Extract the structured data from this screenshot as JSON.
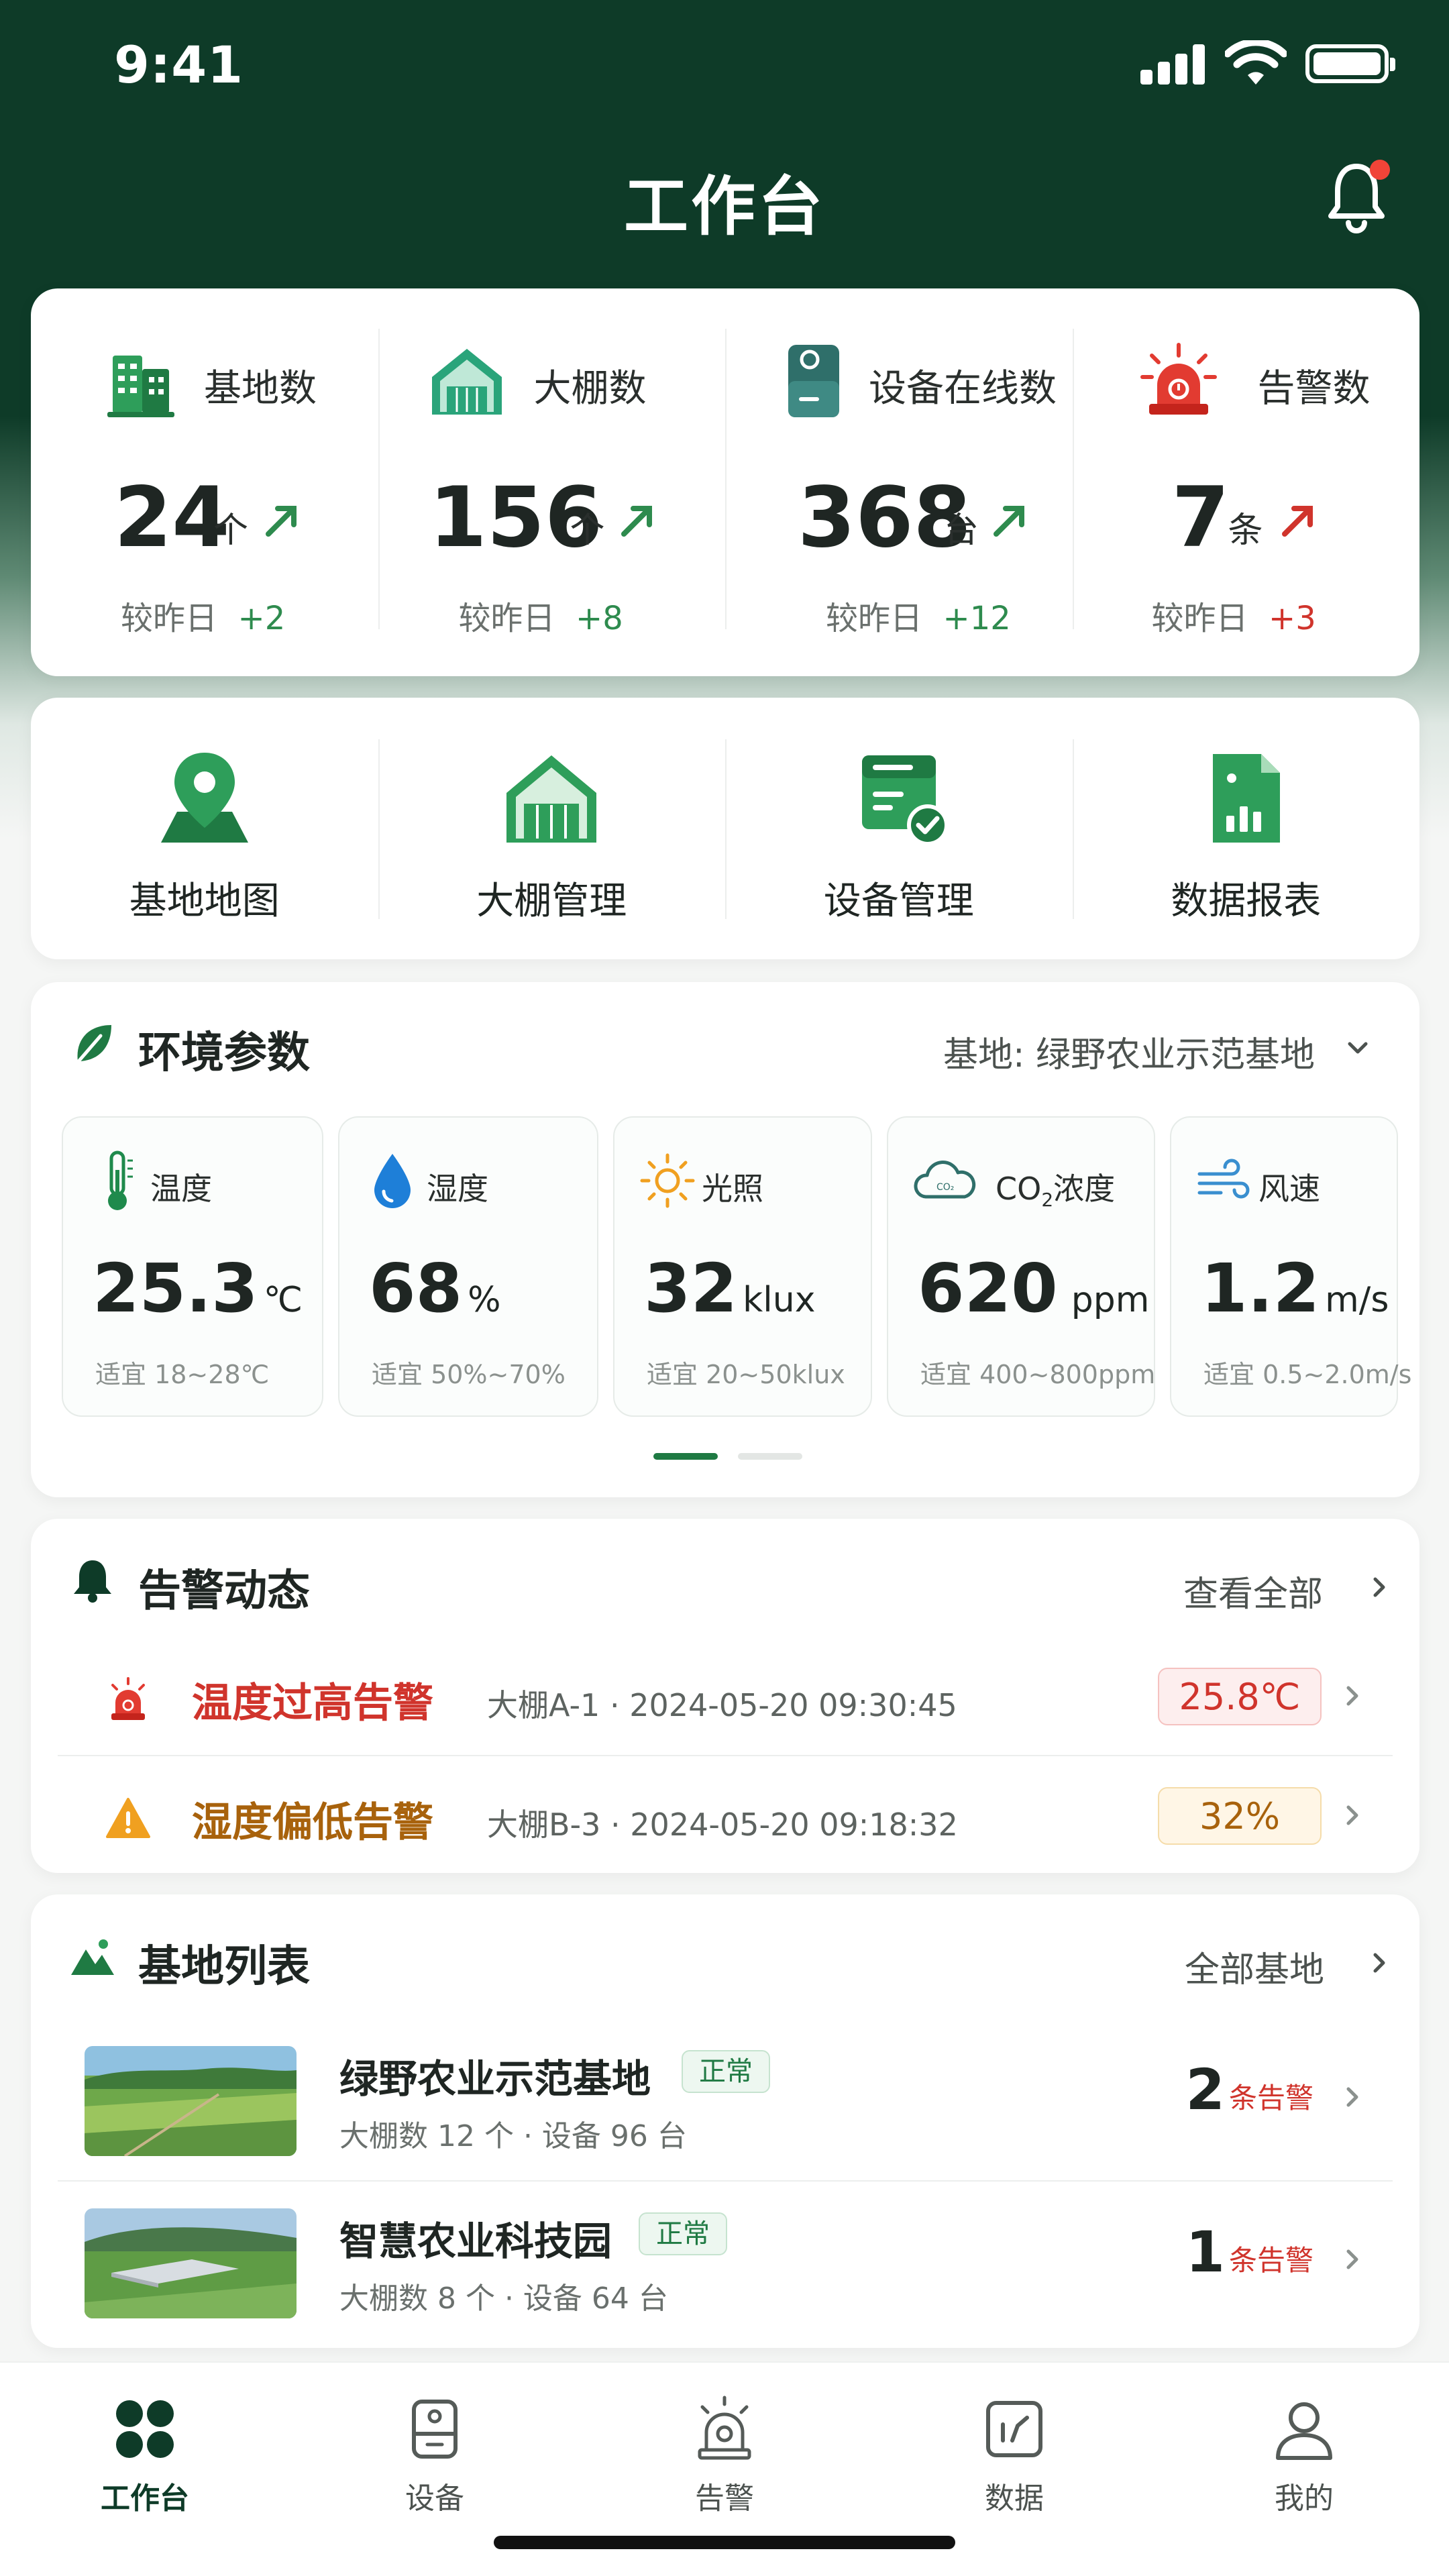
{
  "status_bar": {
    "time": "9:41"
  },
  "header": {
    "title": "工作台"
  },
  "stats": [
    {
      "label": "基地数",
      "value": "24",
      "unit": "个",
      "compare": "较昨日",
      "delta": "+2",
      "delta_color": "#2e8b4e",
      "icon": "buildings-icon"
    },
    {
      "label": "大棚数",
      "value": "156",
      "unit": "个",
      "compare": "较昨日",
      "delta": "+8",
      "delta_color": "#2e8b4e",
      "icon": "greenhouse-icon"
    },
    {
      "label": "设备在线数",
      "value": "368",
      "unit": "台",
      "compare": "较昨日",
      "delta": "+12",
      "delta_color": "#2e8b4e",
      "icon": "device-icon"
    },
    {
      "label": "告警数",
      "value": "7",
      "unit": "条",
      "compare": "较昨日",
      "delta": "+3",
      "delta_color": "#d0342c",
      "icon": "siren-icon"
    }
  ],
  "quick_actions": [
    {
      "label": "基地地图",
      "icon": "map-pin-icon"
    },
    {
      "label": "大棚管理",
      "icon": "greenhouse-icon"
    },
    {
      "label": "设备管理",
      "icon": "device-check-icon"
    },
    {
      "label": "数据报表",
      "icon": "report-icon"
    }
  ],
  "env": {
    "title": "环境参数",
    "base_selector": "基地: 绿野农业示范基地",
    "tiles": [
      {
        "label": "温度",
        "value": "25.3",
        "unit": "℃",
        "range": "适宜  18~28℃",
        "icon": "thermometer-icon"
      },
      {
        "label": "湿度",
        "value": "68",
        "unit": "%",
        "range": "适宜  50%~70%",
        "icon": "droplet-icon"
      },
      {
        "label": "光照",
        "value": "32",
        "unit": "klux",
        "range": "适宜  20~50klux",
        "icon": "sun-icon"
      },
      {
        "label_prefix": "CO",
        "label_sub": "2",
        "label_suffix": "浓度",
        "value": "620",
        "unit": "ppm",
        "range": "适宜  400~800ppm",
        "icon": "cloud-co2-icon"
      },
      {
        "label": "风速",
        "value": "1.2",
        "unit": "m/s",
        "range": "适宜  0.5~2.0m/s",
        "icon": "wind-icon"
      }
    ],
    "page_index": 1,
    "page_count": 2
  },
  "alerts": {
    "title": "告警动态",
    "view_all": "查看全部",
    "items": [
      {
        "title": "温度过高告警",
        "meta": "大棚A-1  ·  2024-05-20  09:30:45",
        "value": "25.8℃",
        "color": "#d0342c",
        "bg": "#fdeeee",
        "border": "#f5c2c0",
        "icon": "siren-icon"
      },
      {
        "title": "湿度偏低告警",
        "meta": "大棚B-3  ·  2024-05-20  09:18:32",
        "value": "32%",
        "color": "#a8620c",
        "bg": "#fff6e6",
        "border": "#f5dcaa",
        "icon": "warning-icon"
      }
    ]
  },
  "bases": {
    "title": "基地列表",
    "all": "全部基地",
    "items": [
      {
        "name": "绿野农业示范基地",
        "status": "正常",
        "meta": "大棚数  12 个  ·  设备  96 台",
        "count": "2",
        "warn": "条告警"
      },
      {
        "name": "智慧农业科技园",
        "status": "正常",
        "meta": "大棚数  8 个  ·  设备  64 台",
        "count": "1",
        "warn": "条告警"
      }
    ]
  },
  "tabbar": [
    {
      "label": "工作台",
      "icon": "grid-icon",
      "active": true
    },
    {
      "label": "设备",
      "icon": "device-icon",
      "active": false
    },
    {
      "label": "告警",
      "icon": "alarm-icon",
      "active": false
    },
    {
      "label": "数据",
      "icon": "chart-icon",
      "active": false
    },
    {
      "label": "我的",
      "icon": "user-icon",
      "active": false
    }
  ],
  "colors": {
    "primary": "#0e3b28",
    "accent": "#1f8a4c",
    "danger": "#d0342c",
    "warning": "#e8a019"
  }
}
